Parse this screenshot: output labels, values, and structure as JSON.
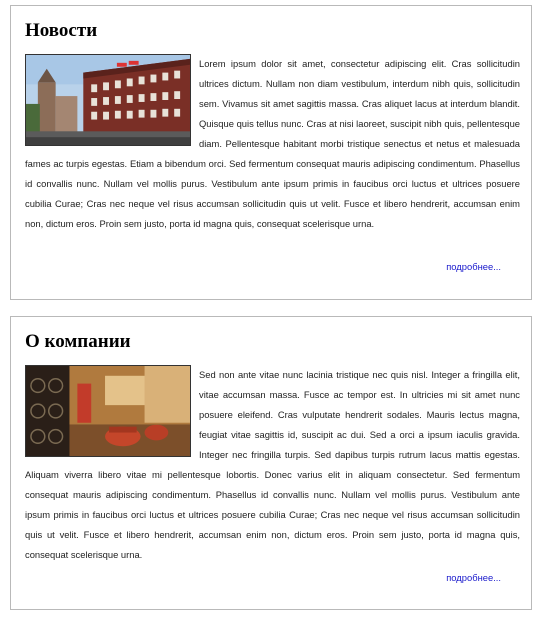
{
  "sections": [
    {
      "title": "Новости",
      "image": "street-buildings-photo",
      "text": "Lorem ipsum dolor sit amet, consectetur adipiscing elit. Cras sollicitudin ultrices dictum. Nullam non diam vestibulum, interdum nibh quis, sollicitudin sem. Vivamus sit amet sagittis massa. Cras aliquet lacus at interdum blandit. Quisque quis tellus nunc. Cras at nisi laoreet, suscipit nibh quis, pellentesque diam. Pellentesque habitant morbi tristique senectus et netus et malesuada fames ac turpis egestas. Etiam a bibendum orci. Sed fermentum consequat mauris adipiscing condimentum. Phasellus id convallis nunc. Nullam vel mollis purus. Vestibulum ante ipsum primis in faucibus orci luctus et ultrices posuere cubilia Curae; Cras nec neque vel risus accumsan sollicitudin quis ut velit. Fusce et libero hendrerit, accumsan enim non, dictum eros. Proin sem justo, porta id magna quis, consequat scelerisque urna.",
      "more": "подробнее..."
    },
    {
      "title": "О компании",
      "image": "hotel-lobby-photo",
      "text": "Sed non ante vitae nunc lacinia tristique nec quis nisl. Integer a fringilla elit, vitae accumsan massa. Fusce ac tempor est. In ultricies mi sit amet nunc posuere eleifend. Cras vulputate hendrerit sodales. Mauris lectus magna, feugiat vitae sagittis id, suscipit ac dui. Sed a orci a ipsum iaculis gravida. Integer nec fringilla turpis. Sed dapibus turpis rutrum lacus mattis egestas. Aliquam viverra libero vitae mi pellentesque lobortis. Donec varius elit in aliquam consectetur. Sed fermentum consequat mauris adipiscing condimentum. Phasellus id convallis nunc. Nullam vel mollis purus. Vestibulum ante ipsum primis in faucibus orci luctus et ultrices posuere cubilia Curae; Cras nec neque vel risus accumsan sollicitudin quis ut velit. Fusce et libero hendrerit, accumsan enim non, dictum eros. Proin sem justo, porta id magna quis, consequat scelerisque urna.",
      "more": "подробнее..."
    }
  ],
  "colors": {
    "link": "#1a1acc",
    "border": "#b9b9b9"
  }
}
